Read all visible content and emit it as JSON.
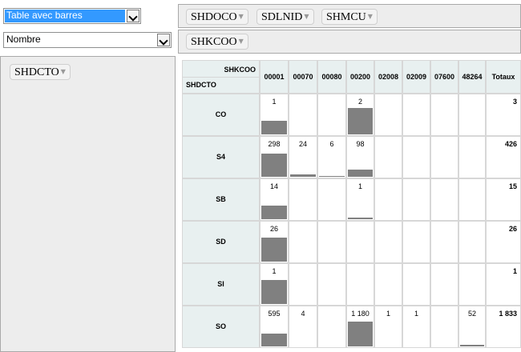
{
  "controls": {
    "renderer": "Table avec barres",
    "aggregator": "Nombre"
  },
  "fields": {
    "unused": [
      "SHDOCO",
      "SDLNID",
      "SHMCU"
    ],
    "cols": [
      "SHKCOO"
    ],
    "rows": [
      "SHDCTO"
    ]
  },
  "table": {
    "col_attr": "SHKCOO",
    "row_attr": "SHDCTO",
    "col_keys": [
      "00001",
      "00070",
      "00080",
      "00200",
      "02008",
      "02009",
      "07600",
      "48264"
    ],
    "totals_label": "Totaux",
    "rows": [
      {
        "label": "CO",
        "cells": [
          "1",
          "",
          "",
          "2",
          "",
          "",
          "",
          ""
        ],
        "total": "3"
      },
      {
        "label": "S4",
        "cells": [
          "298",
          "24",
          "6",
          "98",
          "",
          "",
          "",
          ""
        ],
        "total": "426"
      },
      {
        "label": "SB",
        "cells": [
          "14",
          "",
          "",
          "1",
          "",
          "",
          "",
          ""
        ],
        "total": "15"
      },
      {
        "label": "SD",
        "cells": [
          "26",
          "",
          "",
          "",
          "",
          "",
          "",
          ""
        ],
        "total": "26"
      },
      {
        "label": "SI",
        "cells": [
          "1",
          "",
          "",
          "",
          "",
          "",
          "",
          ""
        ],
        "total": "1"
      },
      {
        "label": "SO",
        "cells": [
          "595",
          "4",
          "",
          "1 180",
          "1",
          "1",
          "",
          "52"
        ],
        "total": "1 833"
      }
    ],
    "bar_fraction": [
      [
        0.35,
        0,
        0,
        0.67,
        0,
        0,
        0,
        0
      ],
      [
        0.6,
        0.06,
        0.02,
        0.18,
        0,
        0,
        0,
        0
      ],
      [
        0.35,
        0,
        0,
        0.05,
        0,
        0,
        0,
        0
      ],
      [
        0.62,
        0,
        0,
        0,
        0,
        0,
        0,
        0
      ],
      [
        0.62,
        0,
        0,
        0,
        0,
        0,
        0,
        0
      ],
      [
        0.33,
        0,
        0,
        0.64,
        0,
        0,
        0,
        0.05
      ]
    ]
  }
}
